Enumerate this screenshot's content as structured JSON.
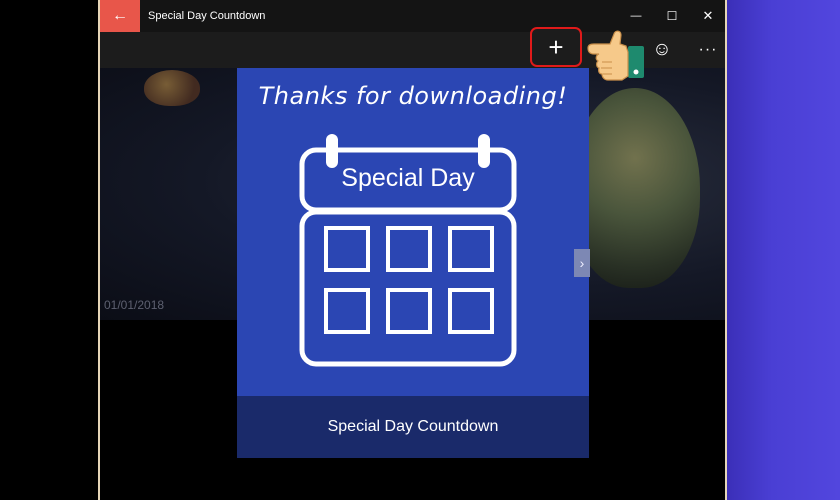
{
  "window": {
    "title": "Special Day Countdown",
    "back_icon": "←",
    "minimize_icon": "—",
    "maximize_icon": "☐",
    "close_icon": "✕"
  },
  "commandbar": {
    "add_icon": "+",
    "emoji_icon": "☺",
    "more_icon": "···"
  },
  "hero": {
    "date": "01/01/2018"
  },
  "card": {
    "heading": "Thanks for downloading!",
    "calendar_label": "Special Day",
    "footer_label": "Special Day Countdown",
    "next_icon": "›"
  },
  "colors": {
    "card_blue": "#2b46b3",
    "card_footer": "#1a2a6a",
    "back_button": "#e8564a",
    "highlight_red": "#e01a1a"
  }
}
